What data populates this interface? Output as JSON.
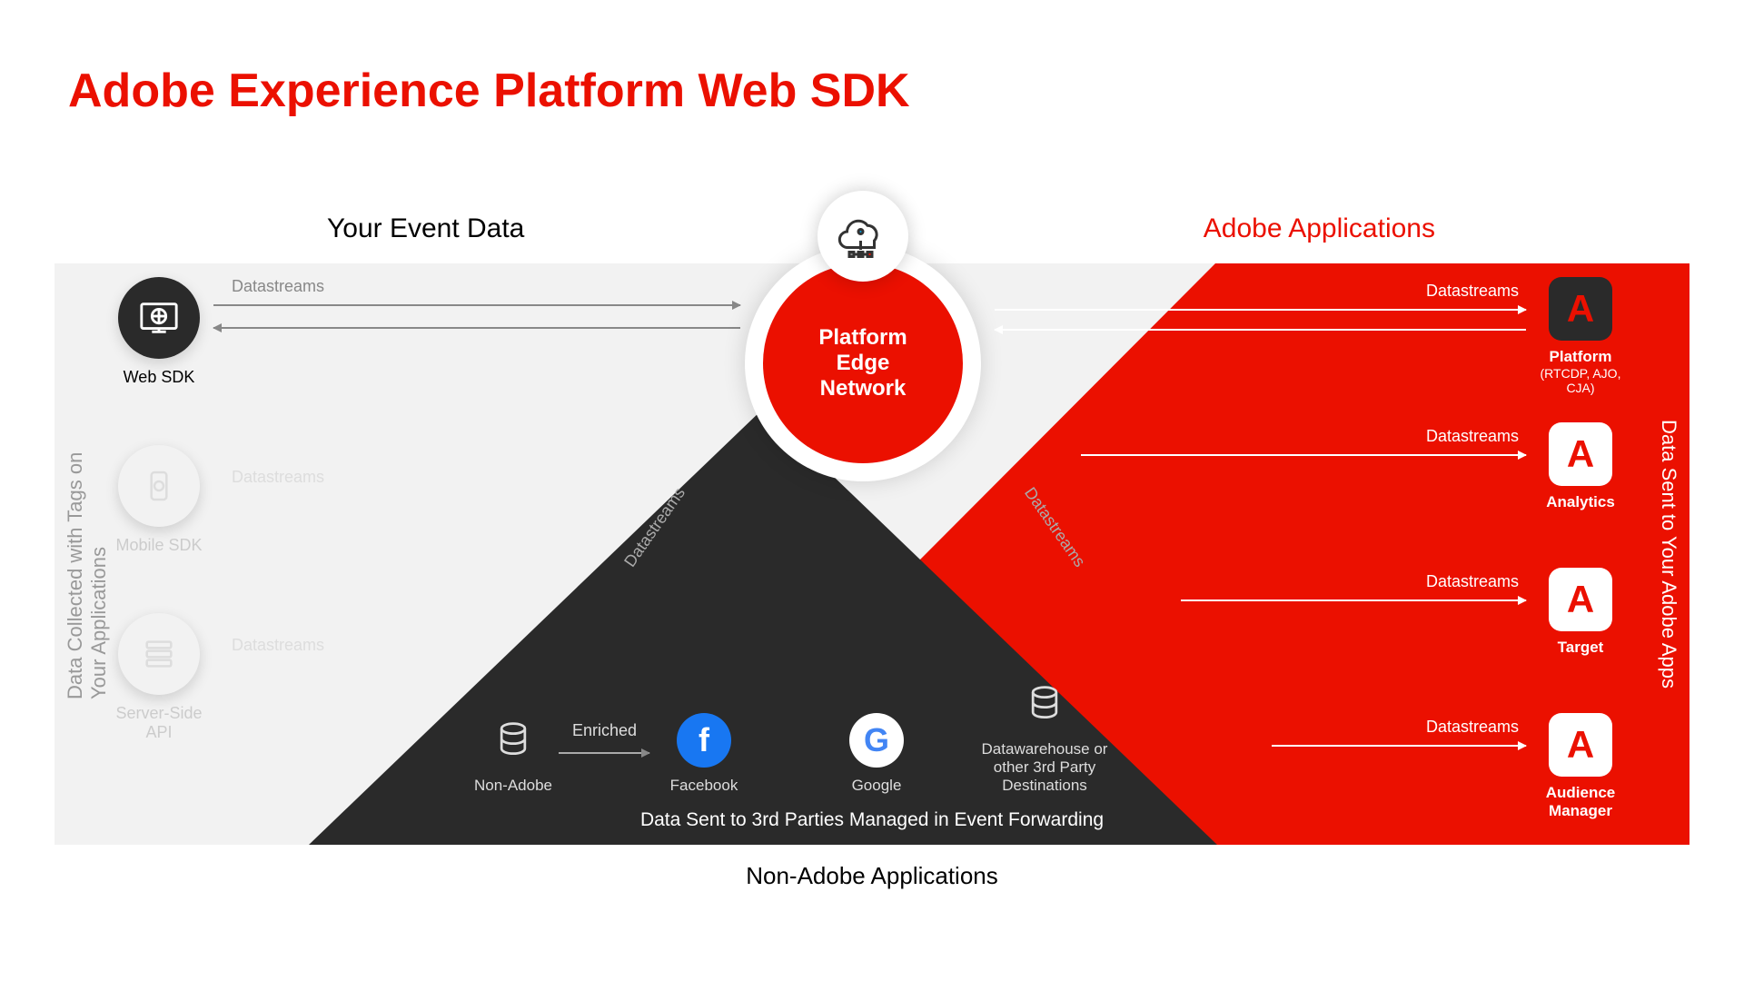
{
  "title": "Adobe Experience Platform Web SDK",
  "sections": {
    "yourEventData": "Your Event Data",
    "adobeApps": "Adobe Applications",
    "nonAdobeApps": "Non-Adobe Applications",
    "leftVert": "Data Collected with Tags on Your Applications",
    "rightVert": "Data Sent to Your Adobe Apps",
    "bottomInner": "Data Sent to 3rd Parties Managed in Event Forwarding"
  },
  "sdks": {
    "web": "Web SDK",
    "mobile": "Mobile SDK",
    "server": "Server-Side API"
  },
  "hub": {
    "line1": "Platform",
    "line2": "Edge",
    "line3": "Network"
  },
  "labels": {
    "datastreams": "Datastreams",
    "enriched": "Enriched"
  },
  "adobeApps": {
    "platform": {
      "name": "Platform",
      "sub": "(RTCDP, AJO, CJA)"
    },
    "analytics": {
      "name": "Analytics"
    },
    "target": {
      "name": "Target"
    },
    "audience": {
      "name": "Audience Manager"
    }
  },
  "thirdParties": {
    "nonAdobe": "Non-Adobe",
    "facebook": "Facebook",
    "google": "Google",
    "warehouse": "Datawarehouse or other 3rd Party Destinations"
  }
}
